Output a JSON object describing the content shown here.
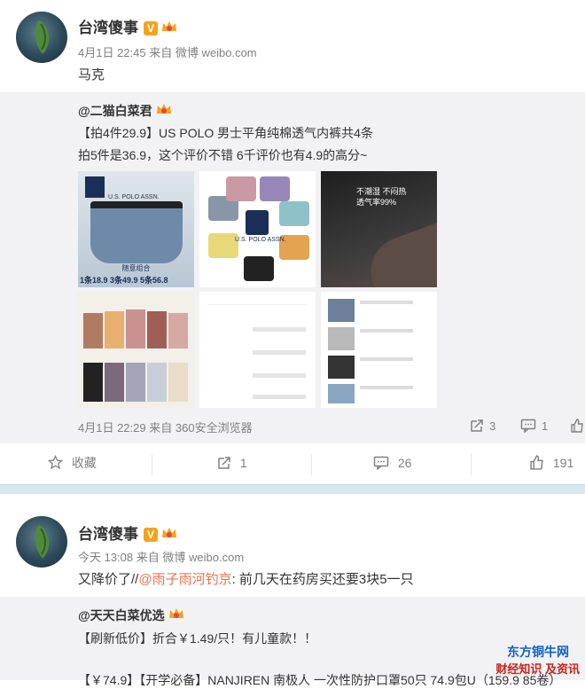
{
  "post1": {
    "user": "台湾傻事",
    "time": "4月1日 22:45",
    "via_prefix": "来自",
    "source": "微博 weibo.com",
    "text": "马克",
    "repost": {
      "user": "@二猫白菜君",
      "line1": "【拍4件29.9】US POLO 男士平角纯棉透气内裤共4条",
      "line2": "拍5件是36.9，这个评价不错 6千评价也有4.9的高分~",
      "time": "4月1日 22:29",
      "via_prefix": "来自",
      "source": "360安全浏览器",
      "repost_count": "3",
      "comment_count": "1",
      "images": {
        "img1_label": "U.S. POLO ASSN.",
        "img1_sub": "随意组合",
        "img1_prices": "1条18.9  3条49.9  5条56.8",
        "img2_label": "U.S. POLO ASSN.",
        "img3_line1": "不潮湿 不闷热",
        "img3_line2": "透气率99%"
      }
    },
    "actions": {
      "fav": "收藏",
      "repost": "1",
      "comment": "26",
      "like": "191"
    }
  },
  "post2": {
    "user": "台湾傻事",
    "time": "今天 13:08",
    "via_prefix": "来自",
    "source": "微博 weibo.com",
    "text_prefix": "又降价了//",
    "mention": "@雨子雨河钓京",
    "text_suffix": ": 前几天在药房买还要3块5一只",
    "repost": {
      "user": "@天天白菜优选",
      "line1": "【刷新低价】折合￥1.49/只！有儿童款！！",
      "line2": "【￥74.9】【开学必备】NANJIREN 南极人 一次性防护口罩50只 74.9包U（159.9 85卷）"
    }
  },
  "watermark": {
    "line1": "东方铜牛网",
    "line2": "财经知识 及资讯"
  },
  "colors": {
    "link": "#eb7350",
    "vip": "#f5a31c",
    "repost_bg": "#f2f2f5",
    "separator": "#d5e8ef"
  }
}
